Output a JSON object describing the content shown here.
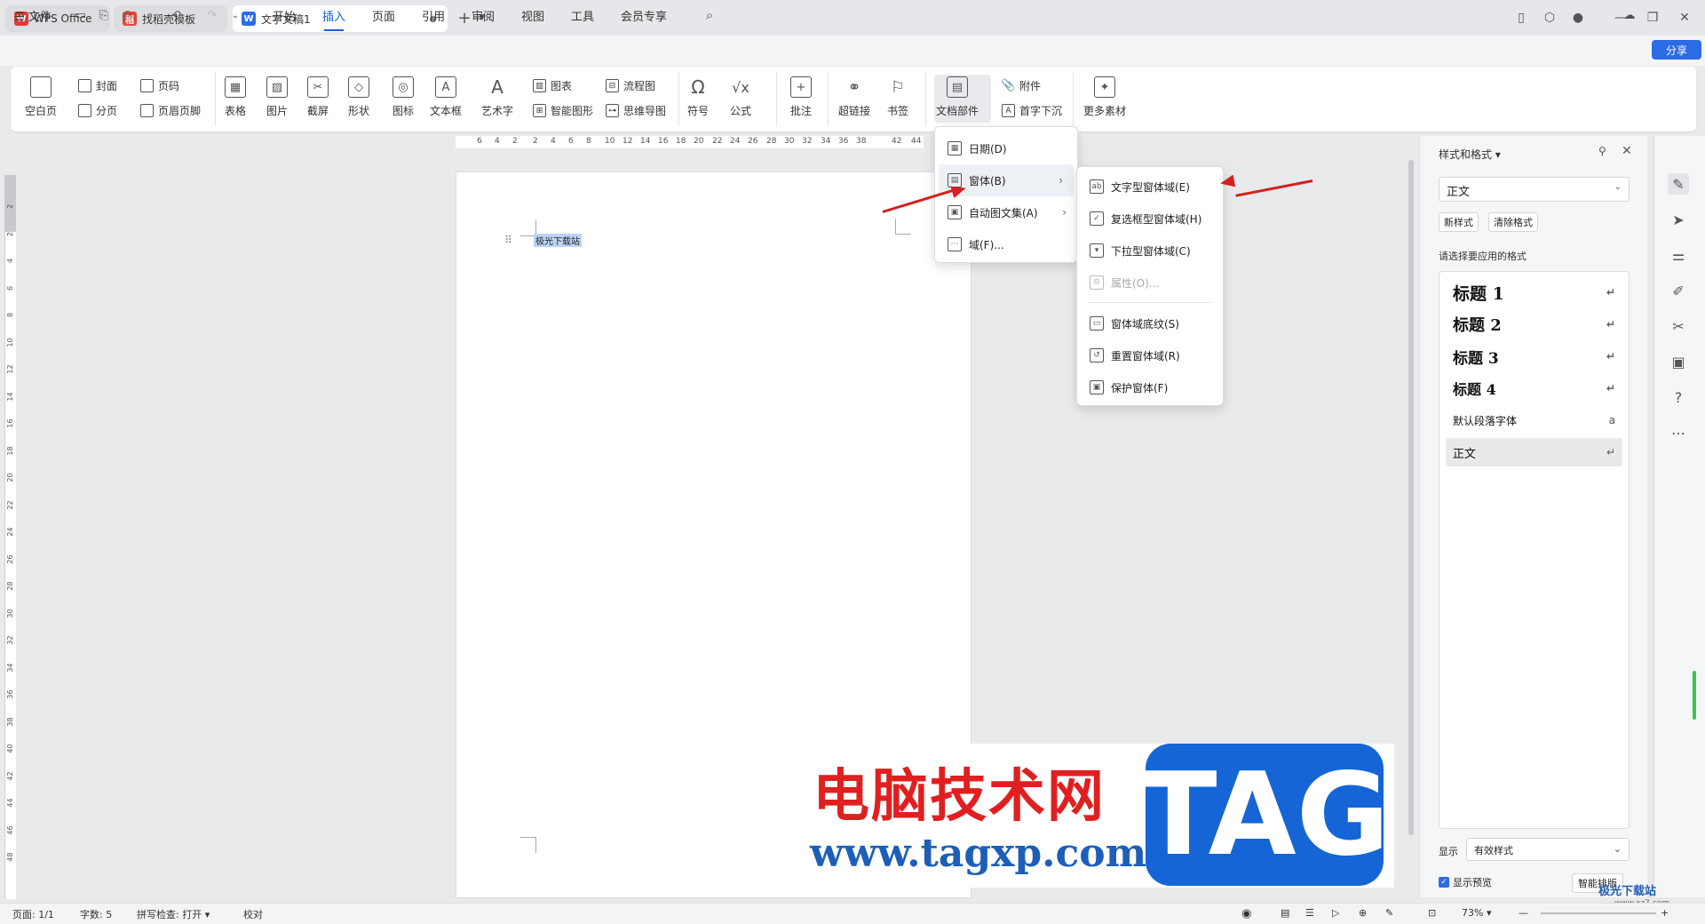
{
  "tabs": [
    {
      "label": "WPS Office"
    },
    {
      "label": "找稻壳模板"
    },
    {
      "label": "文字文稿1"
    }
  ],
  "menubar": {
    "file": "文件",
    "items": [
      "开始",
      "插入",
      "页面",
      "引用",
      "审阅",
      "视图",
      "工具",
      "会员专享"
    ],
    "share": "分享"
  },
  "ribbon": {
    "blank_page": "空白页",
    "cover": "封面",
    "page_num": "页码",
    "section": "分页",
    "header_footer": "页眉页脚",
    "table": "表格",
    "picture": "图片",
    "screenshot": "截屏",
    "shape": "形状",
    "icon": "图标",
    "textbox": "文本框",
    "wordart": "艺术字",
    "chart": "图表",
    "smart_art": "智能图形",
    "flowchart": "流程图",
    "mindmap": "思维导图",
    "symbol": "符号",
    "formula": "公式",
    "comment": "批注",
    "hyperlink": "超链接",
    "bookmark": "书签",
    "doc_parts": "文档部件",
    "attachment": "附件",
    "drop_cap": "首字下沉",
    "more": "更多素材"
  },
  "ruler": {
    "h_ticks": [
      "6",
      "4",
      "2",
      "2",
      "4",
      "6",
      "8",
      "10",
      "12",
      "14",
      "16",
      "18",
      "20",
      "22",
      "24",
      "26",
      "28",
      "30",
      "32",
      "34",
      "36",
      "38",
      "42",
      "44"
    ],
    "v_ticks": [
      "2",
      "2",
      "4",
      "6",
      "8",
      "10",
      "12",
      "14",
      "16",
      "18",
      "20",
      "22",
      "24",
      "26",
      "28",
      "30",
      "32",
      "34",
      "36",
      "38",
      "40",
      "42",
      "44",
      "46",
      "48"
    ]
  },
  "document": {
    "text": "极光下载站"
  },
  "menu_docparts": [
    {
      "label": "日期(D)"
    },
    {
      "label": "窗体(B)"
    },
    {
      "label": "自动图文集(A)"
    },
    {
      "label": "域(F)..."
    }
  ],
  "menu_form": [
    {
      "label": "文字型窗体域(E)"
    },
    {
      "label": "复选框型窗体域(H)"
    },
    {
      "label": "下拉型窗体域(C)"
    },
    {
      "label": "属性(O)..."
    },
    {
      "label": "窗体域底纹(S)"
    },
    {
      "label": "重置窗体域(R)"
    },
    {
      "label": "保护窗体(F)"
    }
  ],
  "panel": {
    "title": "样式和格式",
    "current": "正文",
    "new_style": "新样式",
    "clear_format": "清除格式",
    "hint": "请选择要应用的格式",
    "styles": [
      {
        "label": "标题  1"
      },
      {
        "label": "标题  2"
      },
      {
        "label": "标题  3"
      },
      {
        "label": "标题 4"
      },
      {
        "label": "默认段落字体"
      },
      {
        "label": "正文"
      }
    ],
    "show_label": "显示",
    "show_value": "有效样式",
    "preview": "显示预览",
    "smart": "智能排版"
  },
  "status": {
    "page": "页面: 1/1",
    "words": "字数: 5",
    "spell": "拼写检查: 打开",
    "proof": "校对",
    "zoom": "73%"
  },
  "watermark": {
    "cn": "电脑技术网",
    "url": "www.tagxp.com",
    "tag": "TAG",
    "site": "极光下载站",
    "site_url": "www.xz7.com"
  },
  "colors": {
    "accent": "#1a5fd6",
    "arrow": "#d42020"
  }
}
